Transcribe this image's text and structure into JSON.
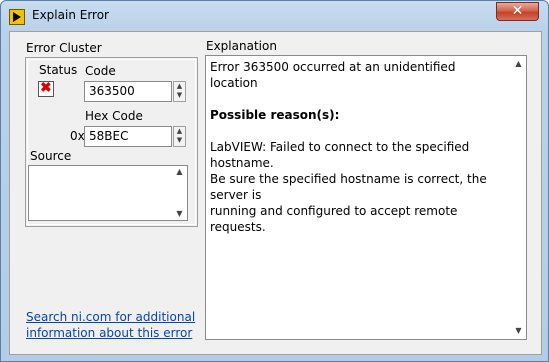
{
  "window": {
    "title": "Explain Error",
    "close_glyph": "✕"
  },
  "error_cluster": {
    "label": "Error Cluster",
    "status_label": "Status",
    "code_label": "Code",
    "code_value": "363500",
    "hex_code_label": "Hex Code",
    "hex_prefix": "0x",
    "hex_value": "58BEC",
    "source_label": "Source",
    "source_value": ""
  },
  "explanation": {
    "label": "Explanation",
    "line1": "Error 363500 occurred at an unidentified location",
    "heading": "Possible reason(s):",
    "line2": "LabVIEW:  Failed to connect to the specified hostname.",
    "line3": "Be sure the specified hostname is correct, the server is",
    "line4": "running and configured to accept remote requests."
  },
  "link": {
    "line1": "Search ni.com for additional",
    "line2": "information about this error"
  },
  "icons": {
    "up_arrow": "▲",
    "down_arrow": "▼"
  }
}
